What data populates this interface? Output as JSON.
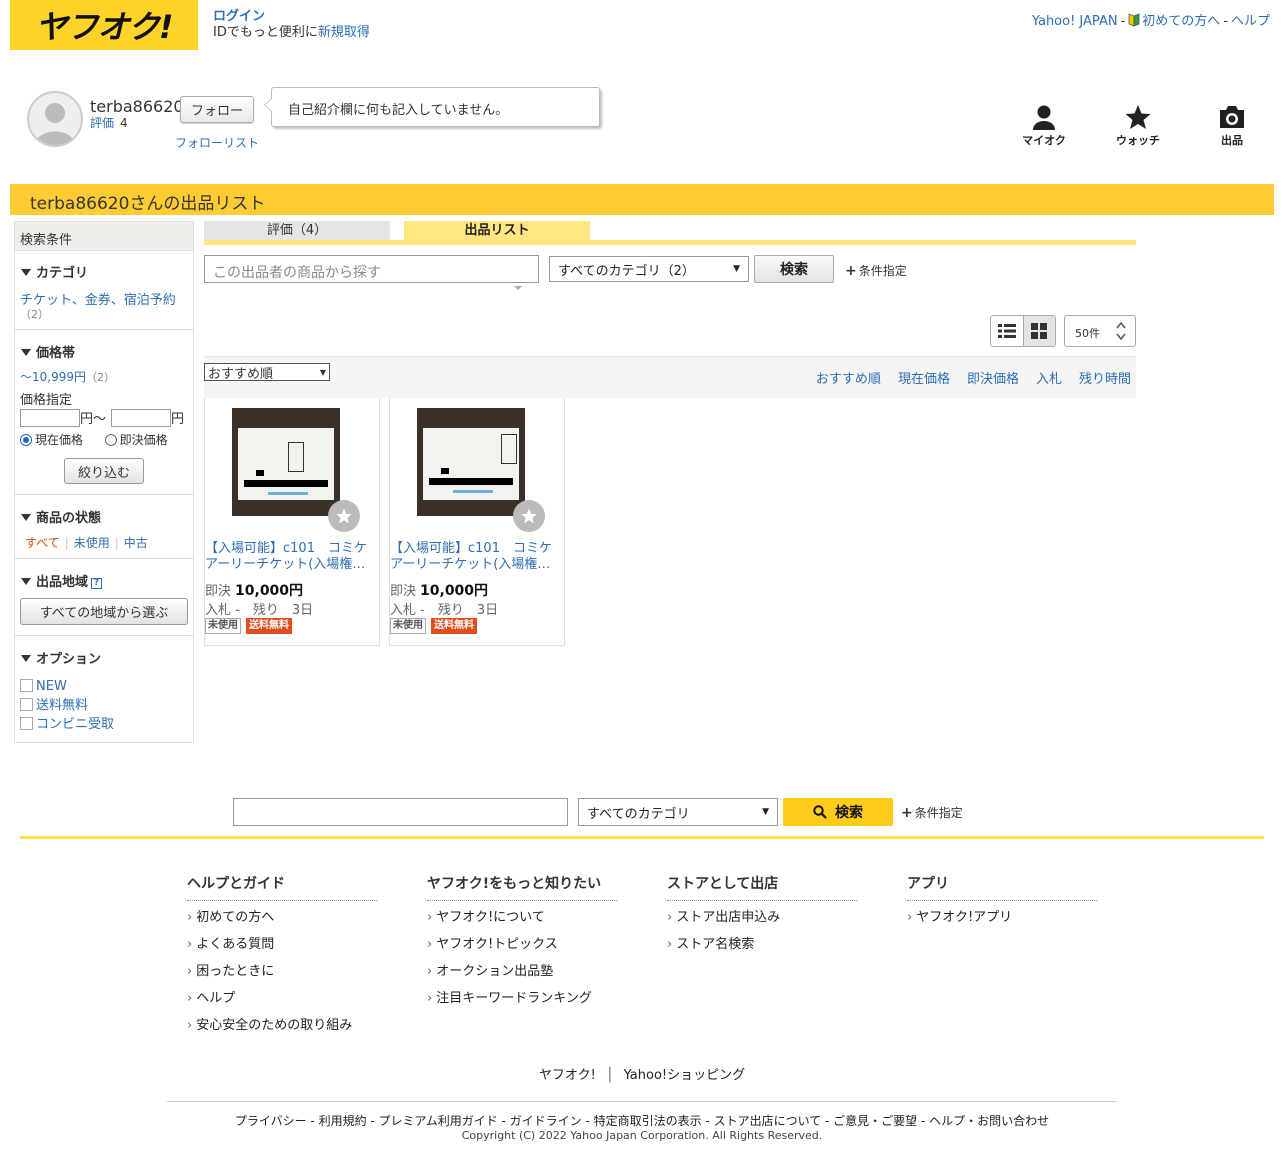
{
  "header": {
    "logo": "ヤフオク!",
    "login": "ログイン",
    "id_text": "IDでもっと便利に",
    "signup": "新規取得",
    "top_links": [
      "Yahoo! JAPAN",
      "初めての方へ",
      "ヘルプ"
    ]
  },
  "profile": {
    "username": "terba86620",
    "rating_label": "評価",
    "rating_count": "4",
    "follow": "フォロー",
    "follow_list": "フォローリスト",
    "bio": "自己紹介欄に何も記入していません。"
  },
  "nav": [
    "マイオク",
    "ウォッチ",
    "出品"
  ],
  "page_title": "terba86620さんの出品リスト",
  "sidebar": {
    "head": "検索条件",
    "category": {
      "title": "カテゴリ",
      "item": "チケット、金券、宿泊予約",
      "count": "（2）"
    },
    "price": {
      "title": "価格帯",
      "range": "〜10,999円",
      "range_count": "（2）",
      "spec_label": "価格指定",
      "yen_from": "円～",
      "yen": "円",
      "radio_current": "現在価格",
      "radio_buynow": "即決価格",
      "filter_btn": "絞り込む"
    },
    "condition": {
      "title": "商品の状態",
      "items": [
        "すべて",
        "未使用",
        "中古"
      ]
    },
    "region": {
      "title": "出品地域",
      "help": "?",
      "btn": "すべての地域から選ぶ"
    },
    "options": {
      "title": "オプション",
      "items": [
        "NEW",
        "送料無料",
        "コンビニ受取"
      ]
    }
  },
  "tabs": [
    "評価（4）",
    "出品リスト"
  ],
  "search": {
    "placeholder": "この出品者の商品から探す",
    "category": "すべてのカテゴリ（2）",
    "btn": "検索",
    "cond": "条件指定"
  },
  "per_page": "50件",
  "sort": {
    "selected": "おすすめ順",
    "links": [
      "おすすめ順",
      "現在価格",
      "即決価格",
      "入札",
      "残り時間"
    ]
  },
  "items": [
    {
      "title": "【入場可能】c101　コミケアーリーチケット(入場権…",
      "price_label": "即決",
      "price": "10,000円",
      "bid": "入札 -　残り　3日",
      "badge_used": "未使用",
      "badge_free": "送料無料"
    },
    {
      "title": "【入場可能】c101　コミケアーリーチケット(入場権…",
      "price_label": "即決",
      "price": "10,000円",
      "bid": "入札 -　残り　3日",
      "badge_used": "未使用",
      "badge_free": "送料無料"
    }
  ],
  "bottom_search": {
    "category": "すべてのカテゴリ",
    "btn": "検索",
    "cond": "条件指定"
  },
  "footer": {
    "cols": [
      {
        "title": "ヘルプとガイド",
        "items": [
          "初めての方へ",
          "よくある質問",
          "困ったときに",
          "ヘルプ",
          "安心安全のための取り組み"
        ]
      },
      {
        "title": "ヤフオク!をもっと知りたい",
        "items": [
          "ヤフオク!について",
          "ヤフオク!トピックス",
          "オークション出品塾",
          "注目キーワードランキング"
        ]
      },
      {
        "title": "ストアとして出店",
        "items": [
          "ストア出店申込み",
          "ストア名検索"
        ]
      },
      {
        "title": "アプリ",
        "items": [
          "ヤフオク!アプリ"
        ]
      }
    ],
    "brands": [
      "ヤフオク!",
      "Yahoo!ショッピング"
    ],
    "links": "プライバシー - 利用規約 - プレミアム利用ガイド - ガイドライン - 特定商取引法の表示 - ストア出店について - ご意見・ご要望 - ヘルプ・お問い合わせ",
    "copyright": "Copyright (C) 2022 Yahoo Japan Corporation. All Rights Reserved."
  },
  "colors": {
    "brand_yellow": "#ffcc33",
    "link": "#2d6db5",
    "free_badge": "#e04e1e"
  }
}
